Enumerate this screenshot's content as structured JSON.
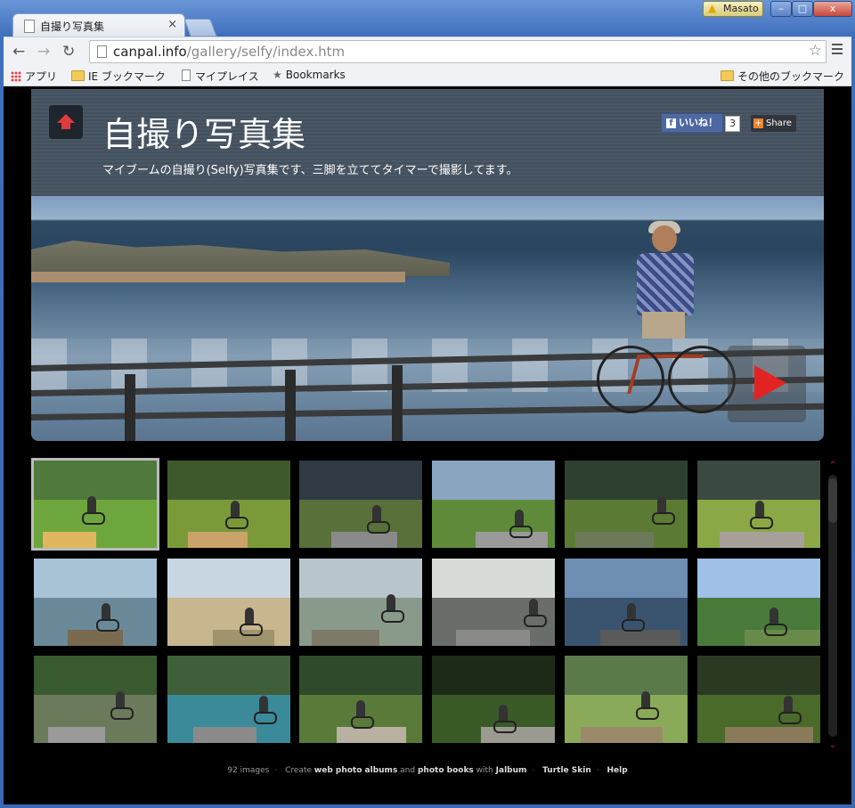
{
  "browser": {
    "tab_title": "自撮り写真集",
    "user_name": "Masato",
    "url_host": "canpal.info",
    "url_path": "/gallery/selfy/index.htm",
    "bookmarks": [
      {
        "label": "アプリ",
        "icon": "apps-icon"
      },
      {
        "label": "IE ブックマーク",
        "icon": "folder-icon"
      },
      {
        "label": "マイプレイス",
        "icon": "page-icon"
      },
      {
        "label": "Bookmarks",
        "icon": "star-icon"
      }
    ],
    "other_bookmarks": "その他のブックマーク"
  },
  "gallery": {
    "title": "自撮り写真集",
    "description": "マイブームの自撮り(Selfy)写真集です、三脚を立ててタイマーで撮影してます。",
    "like_label": "いいね！",
    "like_count": "3",
    "share_label": "Share",
    "thumbnail_count": 18,
    "footer": {
      "images": "92 images",
      "create_prefix": "Create",
      "web_albums": "web photo albums",
      "and": "and",
      "photo_books": "photo books",
      "with": "with",
      "jalbum": "Jalbum",
      "skin": "Turtle Skin",
      "help": "Help"
    }
  },
  "colors": {
    "accent": "#e22323",
    "header_bg": "#4a5866",
    "page_bg": "#000000"
  }
}
